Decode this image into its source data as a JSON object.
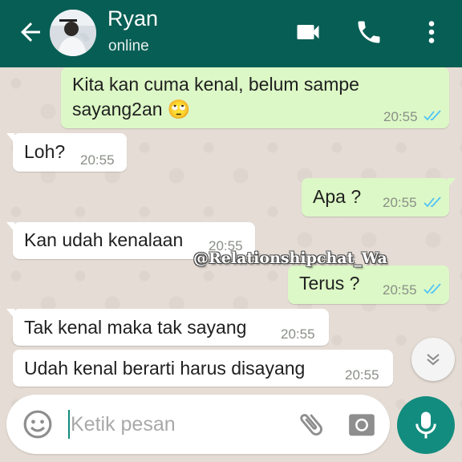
{
  "header": {
    "contact_name": "Ryan",
    "status": "online",
    "icons": [
      "back-arrow-icon",
      "avatar",
      "video-call-icon",
      "phone-call-icon",
      "more-options-icon"
    ]
  },
  "messages": [
    {
      "direction": "out",
      "text_lines": [
        "Kita kan cuma kenal, belum sampe",
        "sayang2an 🙄"
      ],
      "time": "20:55",
      "status": "read"
    },
    {
      "direction": "in",
      "text_lines": [
        "Loh?"
      ],
      "time": "20:55"
    },
    {
      "direction": "out",
      "text_lines": [
        "Apa ?"
      ],
      "time": "20:55",
      "status": "read"
    },
    {
      "direction": "in",
      "text_lines": [
        "Kan udah kenalaan"
      ],
      "time": "20:55"
    },
    {
      "direction": "out",
      "text_lines": [
        "Terus ?"
      ],
      "time": "20:55",
      "status": "read"
    },
    {
      "direction": "in",
      "text_lines": [
        "Tak kenal maka tak sayang"
      ],
      "time": "20:55"
    },
    {
      "direction": "in",
      "text_lines": [
        "Udah kenal berarti harus disayang"
      ],
      "time": "20:55"
    }
  ],
  "watermark": "@Relationshipchat_Wa",
  "composer": {
    "placeholder": "Ketik pesan",
    "icons": [
      "emoji-icon",
      "attach-icon",
      "camera-icon",
      "mic-icon"
    ]
  },
  "colors": {
    "header": "#075e54",
    "outgoing_bubble": "#dcf8c6",
    "incoming_bubble": "#ffffff",
    "read_ticks": "#4fc3f7",
    "mic_button": "#128c7e"
  }
}
